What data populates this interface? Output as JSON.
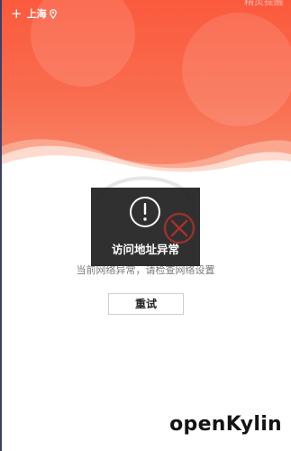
{
  "header": {
    "location_label": "上海",
    "add_icon": "plus-icon",
    "location_icon": "map-pin-icon",
    "top_right_text": "精灵提醒"
  },
  "error_state": {
    "message": "当前网络异常，请检查网络设置",
    "retry_label": "重试",
    "illustration_icon": "network-error-x-icon"
  },
  "toast": {
    "icon": "exclamation-circle-icon",
    "text": "访问地址异常"
  },
  "watermark": {
    "text": "openKylin"
  },
  "colors": {
    "header_top": "#fb5a3d",
    "header_bottom": "#f88a6e",
    "toast_bg": "#1e1e1e",
    "error_red": "#c0392b"
  }
}
